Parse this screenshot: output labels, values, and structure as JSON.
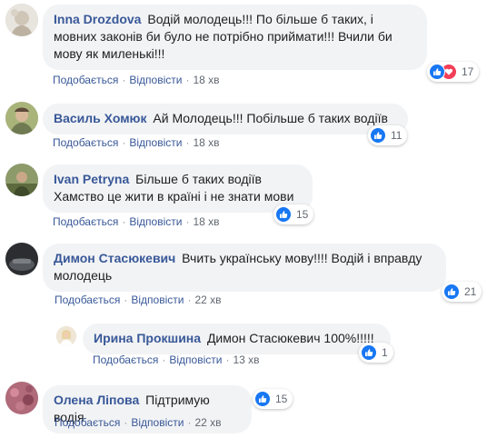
{
  "ui": {
    "like_label": "Подобається",
    "reply_label": "Відповісти",
    "separator": "·"
  },
  "colors": {
    "link": "#385898",
    "bubble": "#f2f3f5",
    "like": "#1877f2",
    "love": "#f33e58"
  },
  "comments": [
    {
      "author": "Inna Drozdova",
      "text": "Водій молодець!!! По більше б таких, і мовних законів би було не потрібно приймати!!! Вчили би мову як миленькі!!!",
      "time": "18 хв",
      "reactions": {
        "icons": [
          "like-icon",
          "love-icon"
        ],
        "count": "17"
      }
    },
    {
      "author": "Василь Хомюк",
      "text": "Ай Молодець!!! Побільше б таких водіїв",
      "time": "18 хв",
      "reactions": {
        "icons": [
          "like-icon"
        ],
        "count": "11"
      }
    },
    {
      "author": "Ivan Petryna",
      "text": "Більше б таких водіїв Хамство це жити в країні і не знати мови",
      "time": "18 хв",
      "reactions": {
        "icons": [
          "like-icon"
        ],
        "count": "15"
      }
    },
    {
      "author": "Димон Стасюкевич",
      "text": "Вчить українську мову!!!! Водій і вправду молодець",
      "time": "22 хв",
      "reactions": {
        "icons": [
          "like-icon"
        ],
        "count": "21"
      }
    },
    {
      "author": "Ирина Прокшина",
      "text": "Димон Стасюкевич 100%!!!!!",
      "time": "13 хв",
      "reactions": {
        "icons": [
          "like-icon"
        ],
        "count": "1"
      }
    },
    {
      "author": "Олена Ліпова",
      "text": "Підтримую водія",
      "time": "22 хв",
      "reactions": {
        "icons": [
          "like-icon"
        ],
        "count": "15"
      }
    }
  ]
}
